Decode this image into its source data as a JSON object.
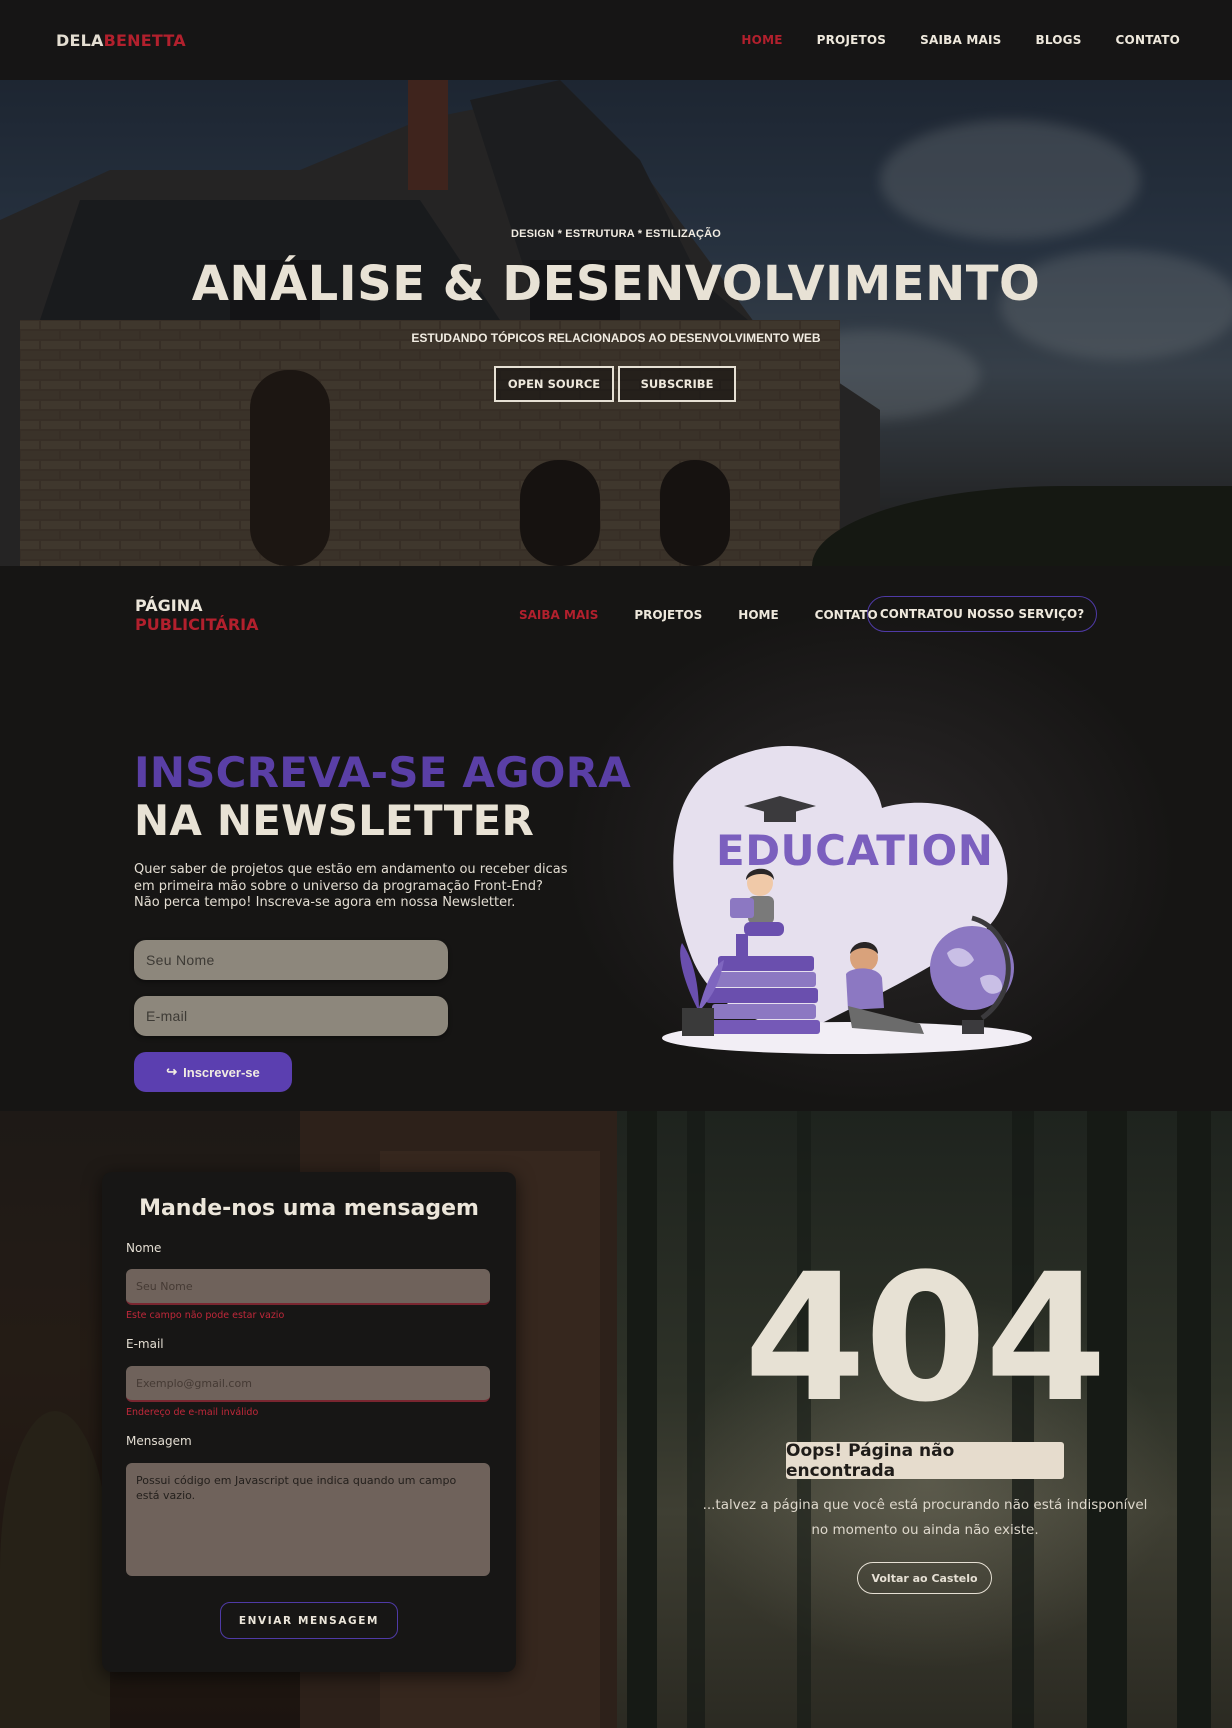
{
  "topnav": {
    "brand_part1": "DELA",
    "brand_part2": "BENETTA",
    "items": [
      {
        "label": "HOME",
        "active": true
      },
      {
        "label": "PROJETOS",
        "active": false
      },
      {
        "label": "SAIBA MAIS",
        "active": false
      },
      {
        "label": "BLOGS",
        "active": false
      },
      {
        "label": "CONTATO",
        "active": false
      }
    ]
  },
  "hero": {
    "kicker": "DESIGN * ESTRUTURA * ESTILIZAÇÃO",
    "title": "ANÁLISE & DESENVOLVIMENTO",
    "subtitle": "ESTUDANDO TÓPICOS RELACIONADOS AO DESENVOLVIMENTO WEB",
    "button_open_source": "OPEN SOURCE",
    "button_subscribe": "SUBSCRIBE"
  },
  "promo": {
    "brand_line1": "PÁGINA",
    "brand_line2": "PUBLICITÁRIA",
    "nav": [
      {
        "label": "SAIBA MAIS",
        "active": true
      },
      {
        "label": "PROJETOS",
        "active": false
      },
      {
        "label": "HOME",
        "active": false
      },
      {
        "label": "CONTATO",
        "active": false
      }
    ],
    "cta_label": "CONTRATOU NOSSO SERVIÇO?"
  },
  "newsletter": {
    "heading_line1": "INSCREVA-SE AGORA",
    "heading_line2": "NA NEWSLETTER",
    "paragraph_line1": "Quer saber de projetos que estão em andamento ou receber dicas",
    "paragraph_line2": "em primeira mão sobre o universo da programação Front-End?",
    "paragraph_line3": "Não perca tempo! Inscreva-se agora em nossa Newsletter.",
    "name_placeholder": "Seu Nome",
    "email_placeholder": "E-mail",
    "submit_icon": "↪",
    "submit_label": "Inscrever-se",
    "illustration_word": "EDUCATION"
  },
  "contact": {
    "title": "Mande-nos uma mensagem",
    "name_label": "Nome",
    "name_placeholder": "Seu Nome",
    "name_error": "Este campo não pode estar vazio",
    "email_label": "E-mail",
    "email_placeholder": "Exemplo@gmail.com",
    "email_error": "Endereço de e-mail inválido",
    "message_label": "Mensagem",
    "message_value": "Possui código em Javascript que indica quando um campo está vazio.",
    "send_label": "ENVIAR MENSAGEM"
  },
  "not_found": {
    "code": "404",
    "badge": "Oops! Página não encontrada",
    "message_line1": "...talvez a página que você está procurando não está indisponível",
    "message_line2": "no momento ou ainda não existe.",
    "back_label": "Voltar ao Castelo"
  },
  "colors": {
    "accent_red": "#b2202d",
    "accent_purple": "#5b3fb0",
    "text_light": "#e8e2d5",
    "panel_dark": "#161514"
  }
}
